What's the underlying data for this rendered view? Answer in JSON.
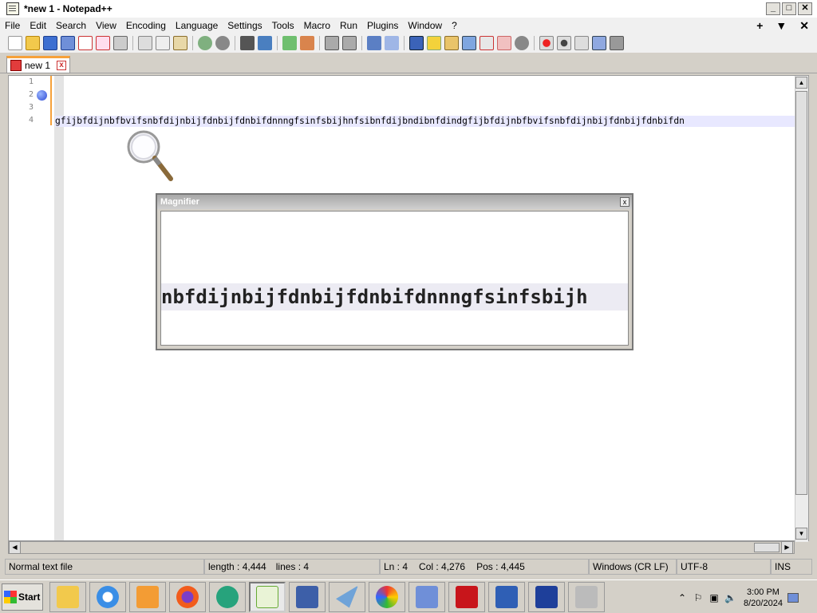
{
  "window": {
    "title": "*new 1 - Notepad++",
    "btn_min": "_",
    "btn_max": "□",
    "btn_close": "✕"
  },
  "menu": [
    "File",
    "Edit",
    "Search",
    "View",
    "Encoding",
    "Language",
    "Settings",
    "Tools",
    "Macro",
    "Run",
    "Plugins",
    "Window",
    "?"
  ],
  "menu_right": {
    "plus": "+",
    "down": "▼",
    "close": "✕"
  },
  "toolbar_icons": [
    "new-file-icon",
    "open-file-icon",
    "save-icon",
    "save-all-icon",
    "close-icon",
    "close-all-icon",
    "print-icon",
    "cut-icon",
    "copy-icon",
    "paste-icon",
    "undo-icon",
    "redo-icon",
    "find-icon",
    "replace-icon",
    "zoom-in-icon",
    "zoom-out-icon",
    "sync-v-icon",
    "sync-h-icon",
    "wrap-icon",
    "all-chars-icon",
    "indent-guide-icon",
    "udl-icon",
    "doc-map-icon",
    "function-list-icon",
    "folder-workspace-icon",
    "monitor-icon",
    "record-icon",
    "stop-icon",
    "play-icon",
    "play-multi-icon",
    "save-macro-icon"
  ],
  "tab": {
    "label": "new 1",
    "close": "x"
  },
  "editor": {
    "line_numbers": [
      "1",
      "2",
      "3",
      "4"
    ],
    "line4_text": "gfijbfdijnbfbvifsnbfdijnbijfdnbijfdnbifdnnngfsinfsbijhnfsibnfdijbndibnfdindgfijbfdijnbfbvifsnbfdijnbijfdnbijfdnbifdn"
  },
  "magnifier": {
    "title": "Magnifier",
    "close": "x",
    "magnified_text": "nbfdijnbijfdnbijfdnbifdnnngfsinfsbijh"
  },
  "status": {
    "file_type": "Normal text file",
    "length": "length : 4,444",
    "lines": "lines : 4",
    "ln": "Ln : 4",
    "col": "Col : 4,276",
    "pos": "Pos : 4,445",
    "eol": "Windows (CR LF)",
    "encoding": "UTF-8",
    "mode": "INS"
  },
  "taskbar": {
    "start": "Start",
    "apps": [
      "explorer-icon",
      "internet-explorer-icon",
      "media-player-icon",
      "firefox-icon",
      "chat-icon",
      "notepadpp-icon",
      "calculator-icon",
      "mail-icon",
      "paint-icon",
      "magnifier-app-icon",
      "acrobat-icon",
      "remote-desktop-icon",
      "visual-studio-icon",
      "printer-icon"
    ],
    "tray": {
      "chevron": "⌃",
      "flag": "⚐",
      "network": "▣",
      "volume": "🔈"
    },
    "time": "3:00 PM",
    "date": "8/20/2024"
  }
}
